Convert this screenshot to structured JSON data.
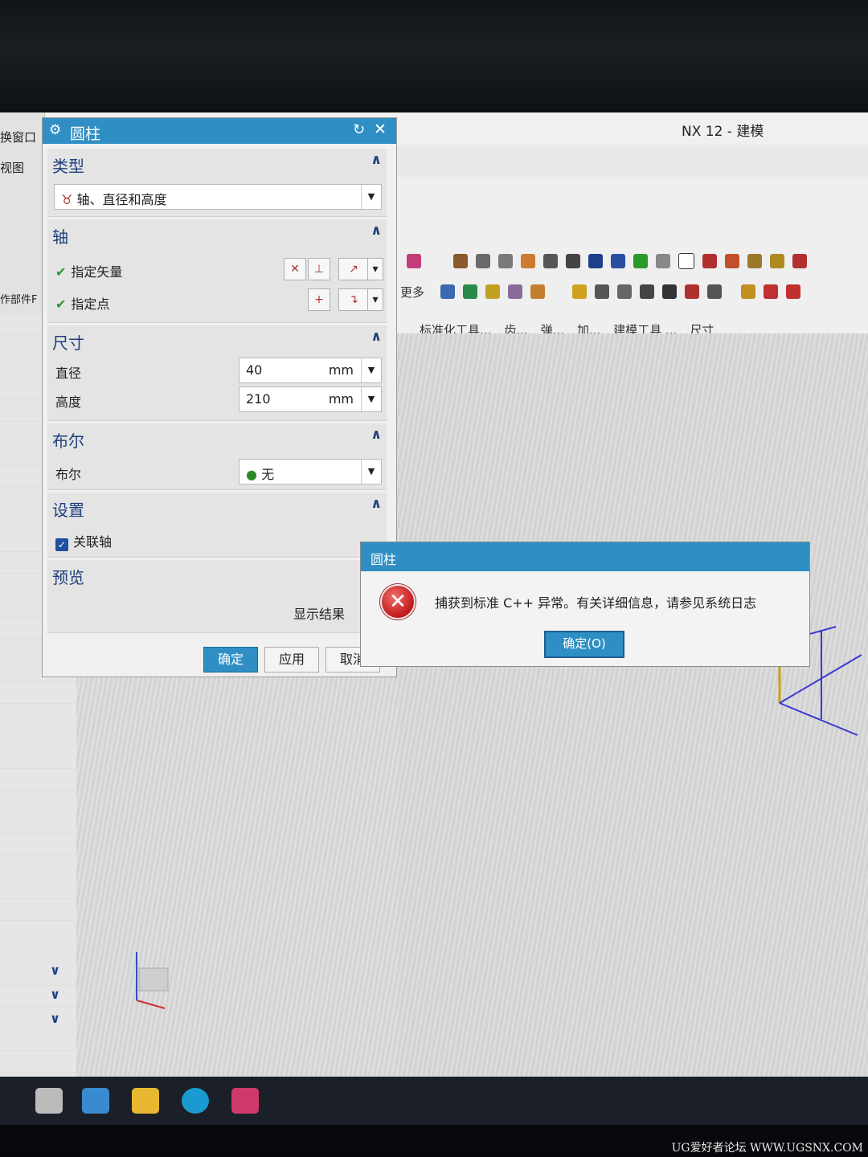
{
  "app": {
    "title": "NX 12 - 建模"
  },
  "left_strip": {
    "window_label": "换窗口",
    "view_label": "视图",
    "part_label": "作部件F"
  },
  "ribbon": {
    "more_label": "更多",
    "groups": [
      "标准化工具...",
      "齿...",
      "弹...",
      "加...",
      "建模工具 ...",
      "尺寸"
    ]
  },
  "cylinder_dialog": {
    "title": "圆柱",
    "type_section": {
      "title": "类型",
      "selected": "轴、直径和高度"
    },
    "axis_section": {
      "title": "轴",
      "vector_label": "指定矢量",
      "point_label": "指定点"
    },
    "size_section": {
      "title": "尺寸",
      "diameter_label": "直径",
      "diameter_value": "40",
      "diameter_unit": "mm",
      "height_label": "高度",
      "height_value": "210",
      "height_unit": "mm"
    },
    "boolean_section": {
      "title": "布尔",
      "label": "布尔",
      "value": "无"
    },
    "settings_section": {
      "title": "设置",
      "assoc_axis_label": "关联轴",
      "assoc_axis_checked": true
    },
    "preview_section": {
      "title": "预览",
      "show_result_label": "显示结果"
    },
    "buttons": {
      "ok": "确定",
      "apply": "应用",
      "cancel": "取消"
    }
  },
  "error_dialog": {
    "title": "圆柱",
    "message": "捕获到标准 C++ 异常。有关详细信息，请参见系统日志",
    "ok_label": "确定(O)"
  },
  "watermark": "UG爱好者论坛 WWW.UGSNX.COM",
  "colors": {
    "accent": "#2f8fc4",
    "section_title": "#1d3f7d",
    "error_red": "#c21818"
  }
}
